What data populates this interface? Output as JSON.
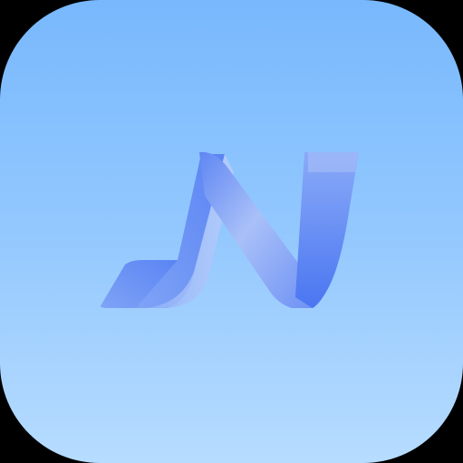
{
  "app_icon": {
    "icon": "n-ribbon-logo-icon",
    "colors": {
      "background_top": "#78b8fd",
      "background_bottom": "#b7dcff",
      "logo_dark": "#4f7cf2",
      "logo_mid": "#7ea2f6",
      "logo_light": "#b3c8f9",
      "corner_background": "#000000"
    }
  }
}
